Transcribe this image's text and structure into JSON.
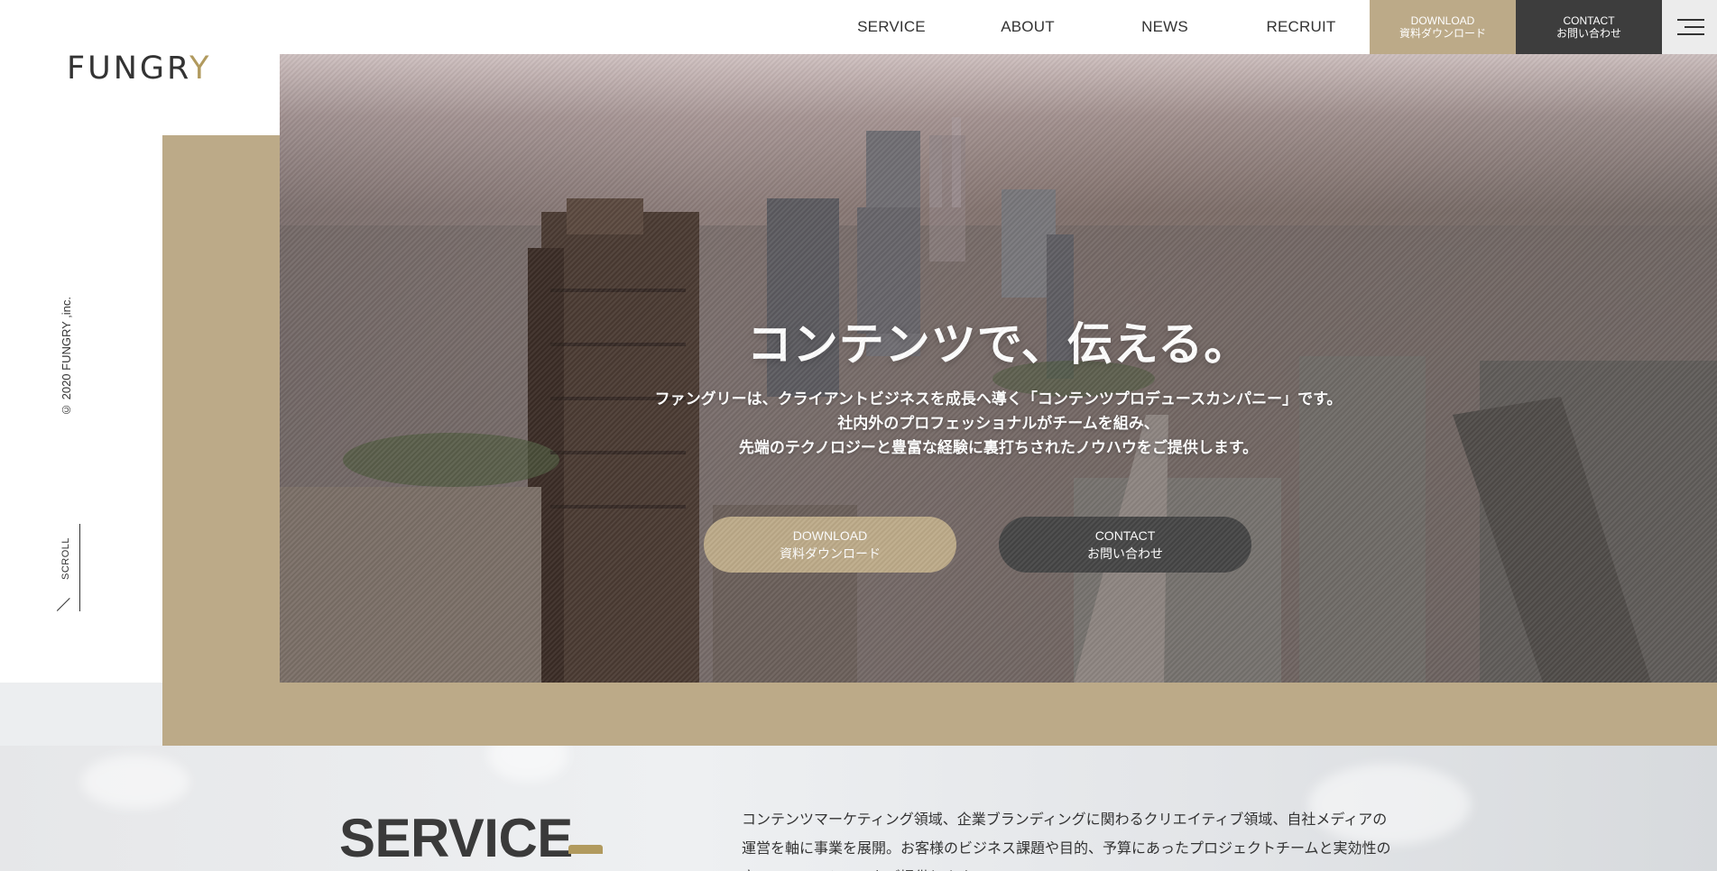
{
  "header": {
    "nav": [
      "SERVICE",
      "ABOUT",
      "NEWS",
      "RECRUIT"
    ],
    "download": {
      "en": "DOWNLOAD",
      "jp": "資料ダウンロード"
    },
    "contact": {
      "en": "CONTACT",
      "jp": "お問い合わせ"
    },
    "menu_icon": "hamburger-menu-icon"
  },
  "logo": {
    "text_main": "FUNGR",
    "text_accent": "Y"
  },
  "sidebar": {
    "copyright": "© 2020 FUNGRY ,inc.",
    "scroll": "SCROLL"
  },
  "hero": {
    "title": "コンテンツで、伝える。",
    "lines": [
      "ファングリーは、クライアントビジネスを成長へ導く「コンテンツプロデュースカンパニー」です。",
      "社内外のプロフェッショナルがチームを組み、",
      "先端のテクノロジーと豊富な経験に裏打ちされたノウハウをご提供します。"
    ],
    "download": {
      "en": "DOWNLOAD",
      "jp": "資料ダウンロード"
    },
    "contact": {
      "en": "CONTACT",
      "jp": "お問い合わせ"
    }
  },
  "service": {
    "title": "SERVICE",
    "text": "コンテンツマーケティング領域、企業ブランディングに関わるクリエイティブ領域、自社メディアの運営を軸に事業を展開。お客様のビジネス課題や目的、予算にあったプロジェクトチームと実効性の高いソリューションをご提供します。"
  },
  "colors": {
    "accent": "#bcaa88",
    "dark": "#3d3d3d",
    "gold": "#b19a5e"
  }
}
